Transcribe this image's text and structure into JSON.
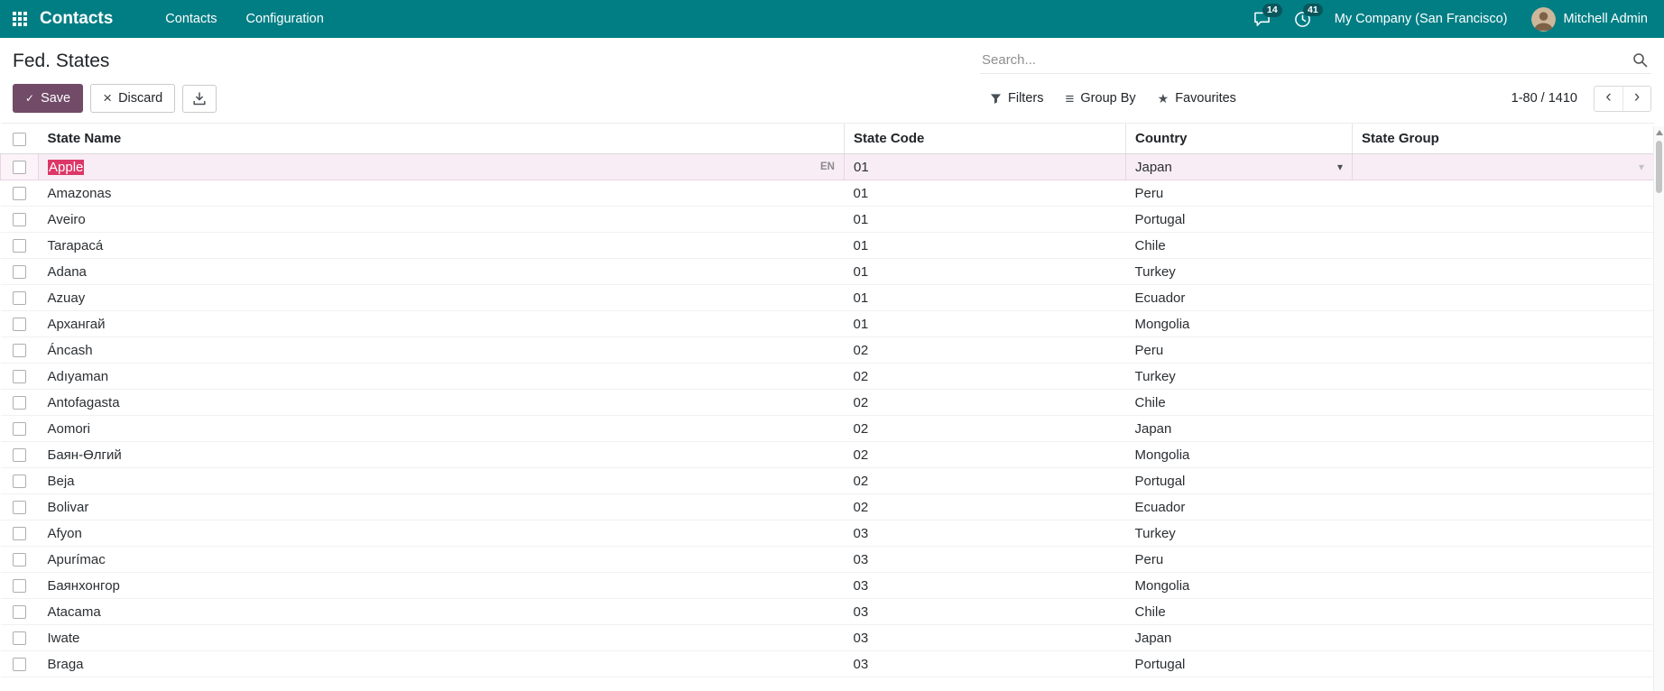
{
  "app": {
    "name": "Contacts",
    "menus": [
      "Contacts",
      "Configuration"
    ],
    "messages_badge": "14",
    "activities_badge": "41",
    "company": "My Company (San Francisco)",
    "user": "Mitchell Admin"
  },
  "control_panel": {
    "title": "Fed. States",
    "save_label": "Save",
    "discard_label": "Discard",
    "search_placeholder": "Search...",
    "filters_label": "Filters",
    "group_by_label": "Group By",
    "favourites_label": "Favourites",
    "pager": "1-80 / 1410"
  },
  "icons": {
    "save_check": "✓",
    "discard_x": "×",
    "group_by_glyph": "≡",
    "favourites_star": "★",
    "pager_prev": "‹",
    "pager_next": "›",
    "dropdown_caret": "▾"
  },
  "colors": {
    "navbar_bg": "#017e84",
    "primary_button_bg": "#714B67",
    "selection_bg": "#dc3768",
    "edit_row_bg": "#f9edf5"
  },
  "table": {
    "columns": [
      "State Name",
      "State Code",
      "Country",
      "State Group"
    ],
    "edit_row": {
      "state_name": "Apple",
      "lang_badge": "EN",
      "state_code": "01",
      "country": "Japan",
      "state_group": ""
    },
    "rows": [
      {
        "state_name": "Amazonas",
        "state_code": "01",
        "country": "Peru",
        "state_group": ""
      },
      {
        "state_name": "Aveiro",
        "state_code": "01",
        "country": "Portugal",
        "state_group": ""
      },
      {
        "state_name": "Tarapacá",
        "state_code": "01",
        "country": "Chile",
        "state_group": ""
      },
      {
        "state_name": "Adana",
        "state_code": "01",
        "country": "Turkey",
        "state_group": ""
      },
      {
        "state_name": "Azuay",
        "state_code": "01",
        "country": "Ecuador",
        "state_group": ""
      },
      {
        "state_name": "Архангай",
        "state_code": "01",
        "country": "Mongolia",
        "state_group": ""
      },
      {
        "state_name": "Áncash",
        "state_code": "02",
        "country": "Peru",
        "state_group": ""
      },
      {
        "state_name": "Adıyaman",
        "state_code": "02",
        "country": "Turkey",
        "state_group": ""
      },
      {
        "state_name": "Antofagasta",
        "state_code": "02",
        "country": "Chile",
        "state_group": ""
      },
      {
        "state_name": "Aomori",
        "state_code": "02",
        "country": "Japan",
        "state_group": ""
      },
      {
        "state_name": "Баян-Өлгий",
        "state_code": "02",
        "country": "Mongolia",
        "state_group": ""
      },
      {
        "state_name": "Beja",
        "state_code": "02",
        "country": "Portugal",
        "state_group": ""
      },
      {
        "state_name": "Bolivar",
        "state_code": "02",
        "country": "Ecuador",
        "state_group": ""
      },
      {
        "state_name": "Afyon",
        "state_code": "03",
        "country": "Turkey",
        "state_group": ""
      },
      {
        "state_name": "Apurímac",
        "state_code": "03",
        "country": "Peru",
        "state_group": ""
      },
      {
        "state_name": "Баянхонгор",
        "state_code": "03",
        "country": "Mongolia",
        "state_group": ""
      },
      {
        "state_name": "Atacama",
        "state_code": "03",
        "country": "Chile",
        "state_group": ""
      },
      {
        "state_name": "Iwate",
        "state_code": "03",
        "country": "Japan",
        "state_group": ""
      },
      {
        "state_name": "Braga",
        "state_code": "03",
        "country": "Portugal",
        "state_group": ""
      }
    ]
  }
}
